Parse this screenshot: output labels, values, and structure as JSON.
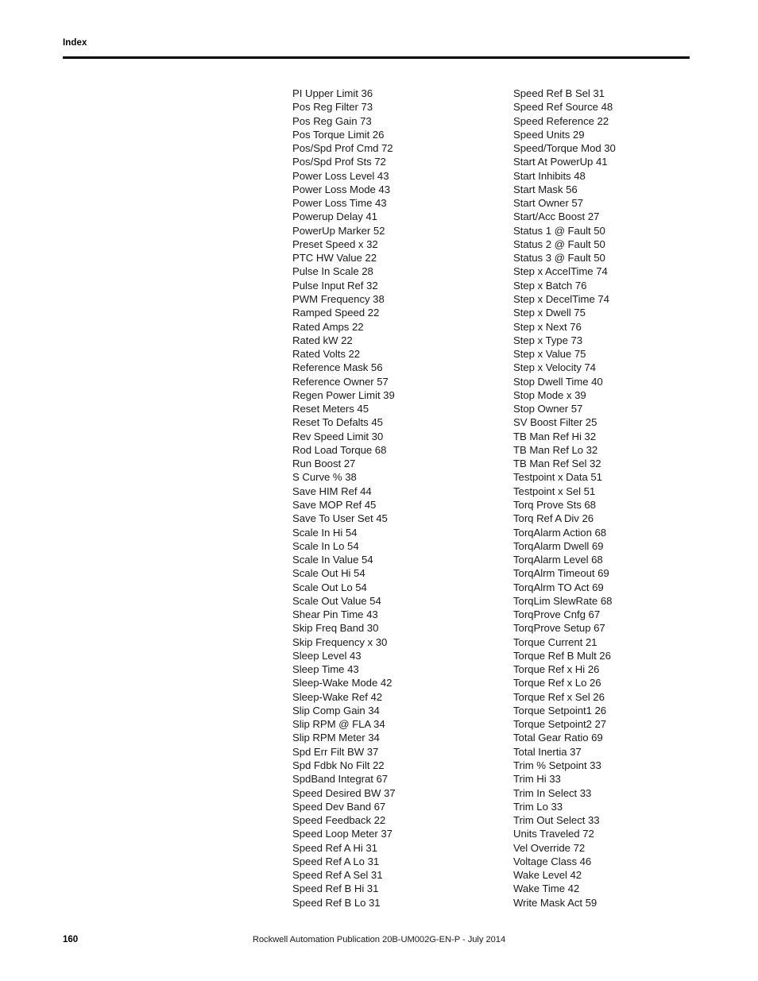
{
  "header": {
    "title": "Index"
  },
  "index": {
    "left_column": [
      "PI Upper Limit 36",
      "Pos Reg Filter 73",
      "Pos Reg Gain 73",
      "Pos Torque Limit 26",
      "Pos/Spd Prof Cmd 72",
      "Pos/Spd Prof Sts 72",
      "Power Loss Level 43",
      "Power Loss Mode 43",
      "Power Loss Time 43",
      "Powerup Delay 41",
      "PowerUp Marker 52",
      "Preset Speed x 32",
      "PTC HW Value 22",
      "Pulse In Scale 28",
      "Pulse Input Ref 32",
      "PWM Frequency 38",
      "Ramped Speed 22",
      "Rated Amps 22",
      "Rated kW 22",
      "Rated Volts 22",
      "Reference Mask 56",
      "Reference Owner 57",
      "Regen Power Limit 39",
      "Reset Meters 45",
      "Reset To Defalts 45",
      "Rev Speed Limit 30",
      "Rod Load Torque 68",
      "Run Boost 27",
      "S Curve % 38",
      "Save HIM Ref 44",
      "Save MOP Ref 45",
      "Save To User Set 45",
      "Scale In Hi 54",
      "Scale In Lo 54",
      "Scale In Value 54",
      "Scale Out Hi 54",
      "Scale Out Lo 54",
      "Scale Out Value 54",
      "Shear Pin Time 43",
      "Skip Freq Band 30",
      "Skip Frequency x 30",
      "Sleep Level 43",
      "Sleep Time 43",
      "Sleep-Wake Mode 42",
      "Sleep-Wake Ref 42",
      "Slip Comp Gain 34",
      "Slip RPM @ FLA 34",
      "Slip RPM Meter 34",
      "Spd Err Filt BW 37",
      "Spd Fdbk No Filt 22",
      "SpdBand Integrat 67",
      "Speed Desired BW 37",
      "Speed Dev Band 67",
      "Speed Feedback 22",
      "Speed Loop Meter 37",
      "Speed Ref A Hi 31",
      "Speed Ref A Lo 31",
      "Speed Ref A Sel 31",
      "Speed Ref B Hi 31",
      "Speed Ref B Lo 31"
    ],
    "right_column": [
      "Speed Ref B Sel 31",
      "Speed Ref Source 48",
      "Speed Reference 22",
      "Speed Units 29",
      "Speed/Torque Mod 30",
      "Start At PowerUp 41",
      "Start Inhibits 48",
      "Start Mask 56",
      "Start Owner 57",
      "Start/Acc Boost 27",
      "Status 1 @ Fault 50",
      "Status 2 @ Fault 50",
      "Status 3 @ Fault 50",
      "Step x AccelTime 74",
      "Step x Batch 76",
      "Step x DecelTime 74",
      "Step x Dwell 75",
      "Step x Next 76",
      "Step x Type 73",
      "Step x Value 75",
      "Step x Velocity 74",
      "Stop Dwell Time 40",
      "Stop Mode x 39",
      "Stop Owner 57",
      "SV Boost Filter 25",
      "TB Man Ref Hi 32",
      "TB Man Ref Lo 32",
      "TB Man Ref Sel 32",
      "Testpoint x Data 51",
      "Testpoint x Sel 51",
      "Torq Prove Sts 68",
      "Torq Ref A Div 26",
      "TorqAlarm Action 68",
      "TorqAlarm Dwell 69",
      "TorqAlarm Level 68",
      "TorqAlrm Timeout 69",
      "TorqAlrm TO Act 69",
      "TorqLim SlewRate 68",
      "TorqProve Cnfg 67",
      "TorqProve Setup 67",
      "Torque Current 21",
      "Torque Ref B Mult 26",
      "Torque Ref x Hi 26",
      "Torque Ref x Lo 26",
      "Torque Ref x Sel 26",
      "Torque Setpoint1 26",
      "Torque Setpoint2 27",
      "Total Gear Ratio 69",
      "Total Inertia 37",
      "Trim % Setpoint 33",
      "Trim Hi 33",
      "Trim In Select 33",
      "Trim Lo 33",
      "Trim Out Select 33",
      "Units Traveled 72",
      "Vel Override 72",
      "Voltage Class 46",
      "Wake Level 42",
      "Wake Time 42",
      "Write Mask Act 59"
    ]
  },
  "footer": {
    "page_number": "160",
    "publication": "Rockwell Automation Publication 20B-UM002G-EN-P - July 2014"
  }
}
